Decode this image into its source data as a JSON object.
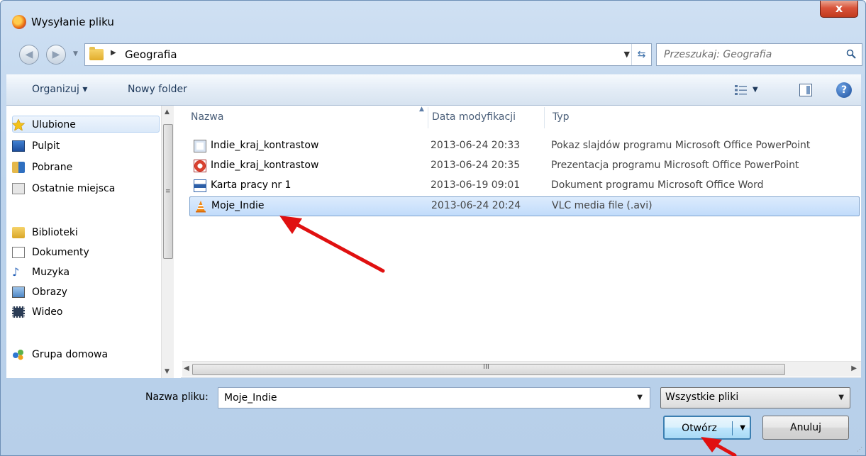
{
  "window": {
    "title": "Wysyłanie pliku",
    "close_label": "x"
  },
  "address": {
    "breadcrumb": "Geografia"
  },
  "search": {
    "placeholder": "Przeszukaj: Geografia"
  },
  "toolbar": {
    "organize_label": "Organizuj ▾",
    "new_folder_label": "Nowy folder"
  },
  "sidebar": {
    "items": [
      {
        "label": "Ulubione",
        "icon": "star-icon"
      },
      {
        "label": "Pulpit",
        "icon": "desktop-icon"
      },
      {
        "label": "Pobrane",
        "icon": "downloads-icon"
      },
      {
        "label": "Ostatnie miejsca",
        "icon": "recent-places-icon"
      },
      {
        "label": "Biblioteki",
        "icon": "libraries-icon"
      },
      {
        "label": "Dokumenty",
        "icon": "documents-icon"
      },
      {
        "label": "Muzyka",
        "icon": "music-icon"
      },
      {
        "label": "Obrazy",
        "icon": "pictures-icon"
      },
      {
        "label": "Wideo",
        "icon": "video-icon"
      },
      {
        "label": "Grupa domowa",
        "icon": "homegroup-icon"
      }
    ]
  },
  "columns": {
    "name": "Nazwa",
    "date": "Data modyfikacji",
    "type": "Typ"
  },
  "files": [
    {
      "name": "Indie_kraj_kontrastow",
      "date": "2013-06-24 20:33",
      "type": "Pokaz slajdów programu Microsoft Office PowerPoint",
      "icon": "powerpoint-show-icon"
    },
    {
      "name": "Indie_kraj_kontrastow",
      "date": "2013-06-24 20:35",
      "type": "Prezentacja programu Microsoft Office PowerPoint",
      "icon": "powerpoint-icon"
    },
    {
      "name": "Karta pracy nr 1",
      "date": "2013-06-19 09:01",
      "type": "Dokument programu Microsoft Office Word",
      "icon": "word-icon"
    },
    {
      "name": "Moje_Indie",
      "date": "2013-06-24 20:24",
      "type": "VLC media file (.avi)",
      "icon": "vlc-icon",
      "selected": true
    }
  ],
  "scroll": {
    "grip": "III"
  },
  "footer": {
    "filename_label": "Nazwa pliku:",
    "filename_value": "Moje_Indie",
    "filter_value": "Wszystkie pliki",
    "open_label": "Otwórz",
    "cancel_label": "Anuluj"
  },
  "colors": {
    "accent": "#3c7fb1",
    "selection": "#c1dcfb",
    "annotation_arrow": "#e01010"
  }
}
